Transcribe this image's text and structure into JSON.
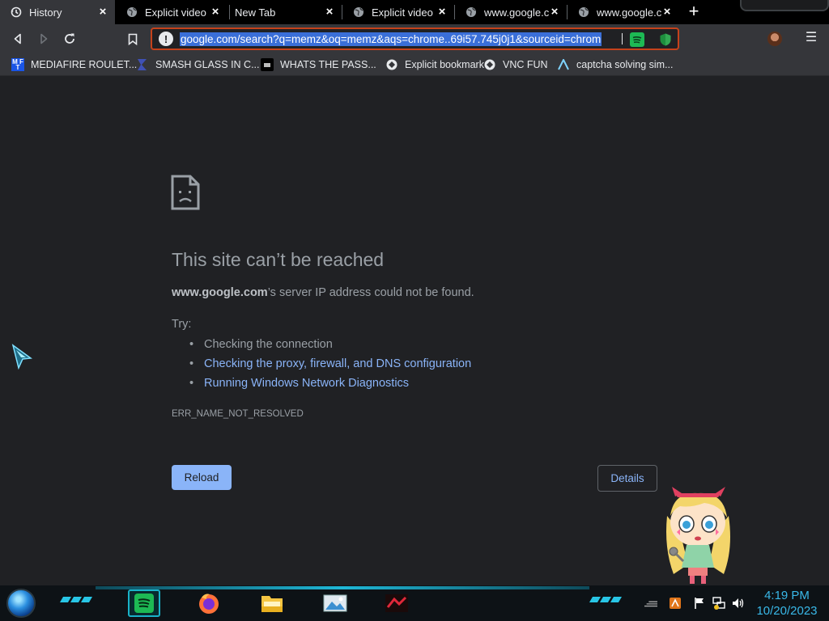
{
  "tabs": [
    {
      "title": "History",
      "icon": "history-icon"
    },
    {
      "title": "Explicit video site",
      "icon": "globe-icon"
    },
    {
      "title": "New Tab",
      "icon": ""
    },
    {
      "title": "Explicit video site",
      "icon": "globe-icon"
    },
    {
      "title": "www.google.co",
      "icon": "globe-icon"
    },
    {
      "title": "www.google.co",
      "icon": "globe-icon"
    }
  ],
  "toolbar": {
    "url": "google.com/search?q=memz&oq=memz&aqs=chrome..69i57.745j0j1&sourceid=chrom"
  },
  "bookmarks": [
    {
      "label": "MEDIAFIRE ROULET...",
      "icon": "mediafire-icon",
      "icon_text": "MF\nT"
    },
    {
      "label": "SMASH GLASS IN C...",
      "icon": "sigma-icon"
    },
    {
      "label": "WHATS THE PASS...",
      "icon": "folder-icon"
    },
    {
      "label": "Explicit bookmark",
      "icon": "puzzle-icon"
    },
    {
      "label": "VNC FUN",
      "icon": "puzzle-icon"
    },
    {
      "label": "captcha solving sim...",
      "icon": "lambda-icon"
    }
  ],
  "error": {
    "title": "This site can’t be reached",
    "host": "www.google.com",
    "desc_rest": "’s server IP address could not be found.",
    "try_label": "Try:",
    "suggestions": [
      "Checking the connection",
      "Checking the proxy, firewall, and DNS configuration",
      "Running Windows Network Diagnostics"
    ],
    "code": "ERR_NAME_NOT_RESOLVED",
    "reload_label": "Reload",
    "details_label": "Details"
  },
  "taskbar": {
    "time": "4:19 PM",
    "date": "10/20/2023"
  },
  "colors": {
    "accent_link": "#8ab4f8",
    "omnibox_border": "#c5421b",
    "clock": "#39b8e8"
  }
}
